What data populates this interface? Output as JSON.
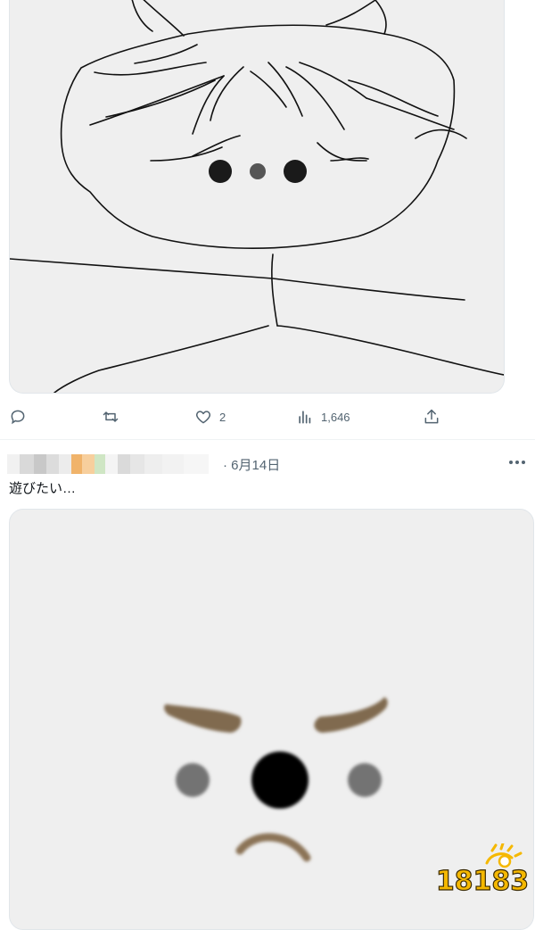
{
  "tweet1": {
    "actions": {
      "reply_count": "",
      "retweet_count": "",
      "like_count": "2",
      "view_count": "1,646"
    },
    "icons": [
      "reply-icon",
      "retweet-icon",
      "like-icon",
      "views-icon",
      "share-icon"
    ]
  },
  "tweet2": {
    "timestamp": "· 6月14日",
    "more_label": "···",
    "text": "遊びたい…",
    "icons": [
      "more-icon"
    ]
  },
  "watermark": {
    "text": "18183",
    "accent_color": "#f5b800"
  },
  "colors": {
    "text_secondary": "#536471",
    "media_bg": "#efefef",
    "eyebrow": "#806a50"
  }
}
